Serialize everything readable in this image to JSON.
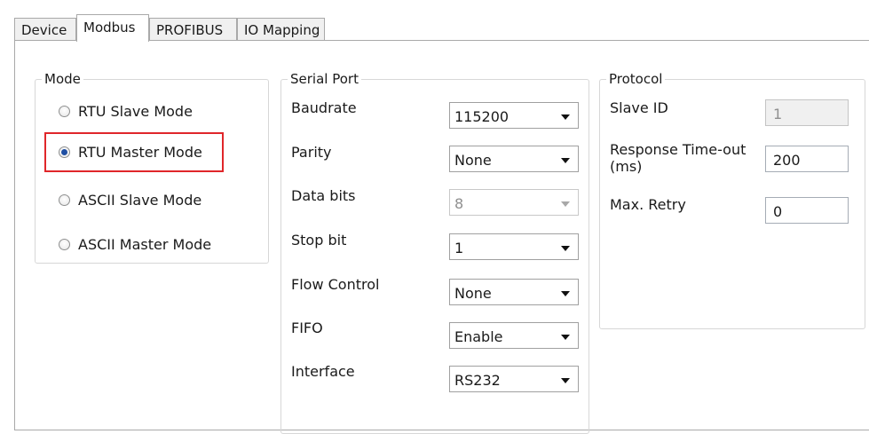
{
  "tabs": [
    {
      "label": "Device"
    },
    {
      "label": "Modbus",
      "active": true
    },
    {
      "label": "PROFIBUS"
    },
    {
      "label": "IO Mapping"
    }
  ],
  "mode": {
    "title": "Mode",
    "options": [
      {
        "label": "RTU Slave Mode",
        "checked": false
      },
      {
        "label": "RTU Master Mode",
        "checked": true
      },
      {
        "label": "ASCII Slave Mode",
        "checked": false
      },
      {
        "label": "ASCII Master Mode",
        "checked": false
      }
    ],
    "highlight_color": "#e0262a"
  },
  "serial_port": {
    "title": "Serial Port",
    "fields": [
      {
        "label": "Baudrate",
        "value": "115200",
        "enabled": true
      },
      {
        "label": "Parity",
        "value": "None",
        "enabled": true
      },
      {
        "label": "Data bits",
        "value": "8",
        "enabled": false
      },
      {
        "label": "Stop bit",
        "value": "1",
        "enabled": true
      },
      {
        "label": "Flow Control",
        "value": "None",
        "enabled": true
      },
      {
        "label": "FIFO",
        "value": "Enable",
        "enabled": true
      },
      {
        "label": "Interface",
        "value": "RS232",
        "enabled": true
      }
    ]
  },
  "protocol": {
    "title": "Protocol",
    "slave_id": {
      "label": "Slave ID",
      "value": "1",
      "enabled": false
    },
    "response_timeout": {
      "label_line1": "Response Time-out",
      "label_line2": "(ms)",
      "value": "200"
    },
    "max_retry": {
      "label": "Max. Retry",
      "value": "0"
    }
  },
  "icons": {
    "radio": "radio-button",
    "dropdown": "chevron-down-icon"
  }
}
